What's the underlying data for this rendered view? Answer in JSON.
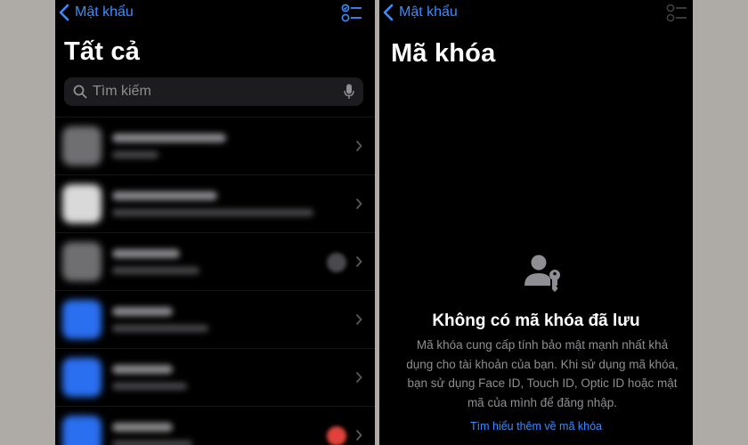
{
  "left": {
    "back_label": "Mật khẩu",
    "title": "Tất cả",
    "search_placeholder": "Tìm kiếm",
    "rows": [
      {
        "thumb": "grey",
        "badge": ""
      },
      {
        "thumb": "white",
        "badge": ""
      },
      {
        "thumb": "grey",
        "badge": "grey"
      },
      {
        "thumb": "fb",
        "badge": ""
      },
      {
        "thumb": "fb",
        "badge": ""
      },
      {
        "thumb": "fb",
        "badge": "red"
      }
    ]
  },
  "right": {
    "back_label": "Mật khẩu",
    "title": "Mã khóa",
    "empty_title": "Không có mã khóa đã lưu",
    "empty_desc": "Mã khóa cung cấp tính bảo mật mạnh nhất khả dụng cho tài khoản của bạn. Khi sử dụng mã khóa, bạn sử dụng Face ID, Touch ID, Optic ID hoặc mật mã của mình để đăng nhập.",
    "learn_more": "Tìm hiểu thêm về mã khóa"
  },
  "colors": {
    "accent": "#3a8cff",
    "background": "#000000",
    "secondary_text": "#8e8e93"
  },
  "icons": [
    "chevron-left-icon",
    "checklist-icon",
    "magnifier-icon",
    "microphone-icon",
    "chevron-right-icon",
    "person-key-icon"
  ]
}
